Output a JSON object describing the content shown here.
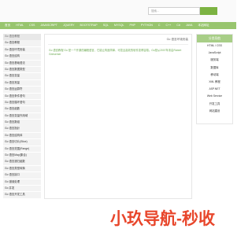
{
  "search": {
    "placeholder": "搜索..."
  },
  "nav": [
    "首页",
    "HTML",
    "CSS",
    "JAVASCRIPT",
    "JQUERY",
    "BOOTSTRAP",
    "SQL",
    "MYSQL",
    "PHP",
    "PYTHON",
    "C",
    "C++",
    "C#",
    "JAVA",
    "本站网址"
  ],
  "sidebar": {
    "items": [
      "Go 语言教程",
      "Go 语言教程",
      "Go 语言环境安装",
      "Go 语言结构",
      "Go 语言基础语法",
      "Go 语言数据类型",
      "Go 语言变量",
      "Go 语言常量",
      "Go 语言运算符",
      "Go 语言条件语句",
      "Go 语言循环语句",
      "Go 语言函数",
      "Go 语言变量作用域",
      "Go 语言数组",
      "Go 语言指针",
      "Go 语言结构体",
      "Go 语言切片(Slice)",
      "Go 语言范围(Range)",
      "Go 语言Map(集合)",
      "Go 语言递归函数",
      "Go 语言类型转换",
      "Go 语言接口",
      "Go 错误处理",
      "Go 并发",
      "Go 语言开发工具"
    ]
  },
  "main": {
    "title": "Go 语言环境安装",
    "text": "Go 语言教程 Go 是一个开源的编程语言，它能让构造简单、可靠且高效的软件变得容易。Go是从2007年末由Robert Griesemer"
  },
  "right": {
    "heading": "分类导航",
    "items": [
      "HTML / CSS",
      "JavaScript",
      "服务端",
      "数据库",
      "移动端",
      "XML 教程",
      "ASP.NET",
      "Web Service",
      "开发工具",
      "网站建设"
    ]
  },
  "watermark": "小玖导航-秒收"
}
